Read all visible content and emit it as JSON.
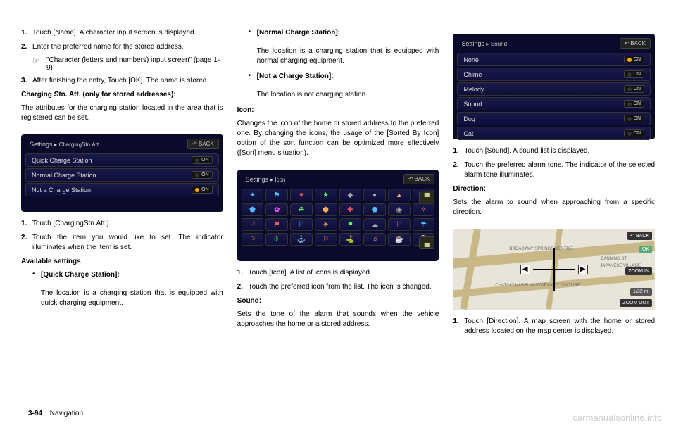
{
  "col1": {
    "step1": {
      "num": "1.",
      "text": "Touch [Name]. A character input screen is displayed."
    },
    "step2": {
      "num": "2.",
      "text": "Enter the preferred name for the stored address."
    },
    "ref": {
      "icon": "☞",
      "text": "\"Character (letters and numbers) input screen\" (page 1-9)"
    },
    "step3": {
      "num": "3.",
      "text": "After finishing the entry, Touch [OK]. The name is stored."
    },
    "heading1": "Charging Stn. Att. (only for stored addresses):",
    "para1": "The attributes for the charging station located in the area that is registered can be set.",
    "ss1": {
      "title": "Settings",
      "crumb": "ChargingStn.Att.",
      "back": "BACK",
      "rows": [
        {
          "label": "Quick Charge Station",
          "on": false
        },
        {
          "label": "Normal Charge Station",
          "on": false
        },
        {
          "label": "Not a Charge Station",
          "on": true
        }
      ]
    },
    "step4": {
      "num": "1.",
      "text": "Touch [ChargingStn.Att.]."
    },
    "step5": {
      "num": "2.",
      "text": "Touch the item you would like to set. The indicator illuminates when the item is set."
    },
    "heading2": "Available settings",
    "bullet1": {
      "title": "[Quick Charge Station]:",
      "body": "The location is a charging station that is equipped with quick charging equipment."
    }
  },
  "col2": {
    "bullet1": {
      "title": "[Normal Charge Station]:",
      "body": "The location is a charging station that is equipped with normal charging equipment."
    },
    "bullet2": {
      "title": "[Not a Charge Station]:",
      "body": "The location is not charging station."
    },
    "heading1": "Icon:",
    "para1": "Changes the icon of the home or stored address to the preferred one. By changing the icons, the usage of the [Sorted By Icon] option of the sort function can be optimized more effectively ([Sort] menu situation).",
    "ss2": {
      "title": "Settings",
      "crumb": "Icon",
      "back": "BACK"
    },
    "step1": {
      "num": "1.",
      "text": "Touch [Icon]. A list of icons is displayed."
    },
    "step2": {
      "num": "2.",
      "text": "Touch the preferred icon from the list. The icon is changed."
    },
    "heading2": "Sound:",
    "para2": "Sets the tone of the alarm that sounds when the vehicle approaches the home or a stored address."
  },
  "col3": {
    "ss3": {
      "title": "Settings",
      "crumb": "Sound",
      "back": "BACK",
      "rows": [
        {
          "label": "None",
          "on": true
        },
        {
          "label": "Chime",
          "on": false
        },
        {
          "label": "Melody",
          "on": false
        },
        {
          "label": "Sound",
          "on": false
        },
        {
          "label": "Dog",
          "on": false
        },
        {
          "label": "Cat",
          "on": false
        }
      ]
    },
    "step1": {
      "num": "1.",
      "text": "Touch [Sound]. A sound list is displayed."
    },
    "step2": {
      "num": "2.",
      "text": "Touch the preferred alarm tone. The indicator of the selected alarm tone illuminates."
    },
    "heading1": "Direction:",
    "para1": "Sets the alarm to sound when approaching from a specific direction.",
    "map": {
      "back": "BACK",
      "ok": "OK",
      "zoomin": "ZOOM IN",
      "zoomout": "ZOOM OUT",
      "scale": "1/32 mi",
      "label1": "BROADWAY SPRINGS CENTRE",
      "label2": "BANNING ST",
      "label3": "JAPANESE VILLAGE",
      "label4": "CHATINO MUSEUM-STORY/ART CULTURE"
    },
    "step3": {
      "num": "1.",
      "text": "Touch [Direction]. A map screen with the home or stored address located on the map center is displayed."
    }
  },
  "footer": {
    "page": "3-94",
    "section": "Navigation"
  },
  "watermark": "carmanualsonline.info"
}
